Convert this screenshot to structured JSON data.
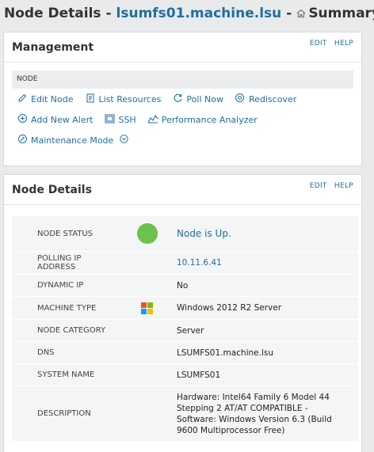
{
  "header": {
    "title_prefix": "Node Details -",
    "node_name": "lsumfs01.machine.lsu",
    "separator": "-",
    "view_name": "Summary",
    "status_color": "#6cc24a"
  },
  "management": {
    "title": "Management",
    "edit_label": "EDIT",
    "help_label": "HELP",
    "section_label": "NODE",
    "actions": [
      {
        "label": "Edit Node",
        "icon": "pencil-icon"
      },
      {
        "label": "List Resources",
        "icon": "list-icon"
      },
      {
        "label": "Poll Now",
        "icon": "refresh-icon"
      },
      {
        "label": "Rediscover",
        "icon": "rediscover-icon"
      },
      {
        "label": "Add New Alert",
        "icon": "plus-circle-icon"
      },
      {
        "label": "SSH",
        "icon": "terminal-icon"
      },
      {
        "label": "Performance Analyzer",
        "icon": "performance-icon"
      },
      {
        "label": "Maintenance Mode",
        "icon": "maintenance-icon"
      }
    ]
  },
  "node_details": {
    "title": "Node Details",
    "edit_label": "EDIT",
    "help_label": "HELP",
    "rows": {
      "node_status": {
        "label": "NODE STATUS",
        "value": "Node is Up."
      },
      "polling_ip": {
        "label": "POLLING IP ADDRESS",
        "value": "10.11.6.41"
      },
      "dynamic_ip": {
        "label": "DYNAMIC IP",
        "value": "No"
      },
      "machine_type": {
        "label": "MACHINE TYPE",
        "value": "Windows 2012 R2 Server"
      },
      "node_category": {
        "label": "NODE CATEGORY",
        "value": "Server"
      },
      "dns": {
        "label": "DNS",
        "value": "LSUMFS01.machine.lsu"
      },
      "system_name": {
        "label": "SYSTEM NAME",
        "value": "LSUMFS01"
      },
      "description": {
        "label": "DESCRIPTION",
        "value": "Hardware: Intel64 Family 6 Model 44 Stepping 2 AT/AT COMPATIBLE - Software: Windows Version 6.3 (Build 9600 Multiprocessor Free)"
      }
    }
  },
  "colors": {
    "link": "#1f6e9f",
    "status_up": "#6cc24a",
    "windows_logo": [
      "#f25022",
      "#7fba00",
      "#00a4ef",
      "#ffb900"
    ]
  }
}
